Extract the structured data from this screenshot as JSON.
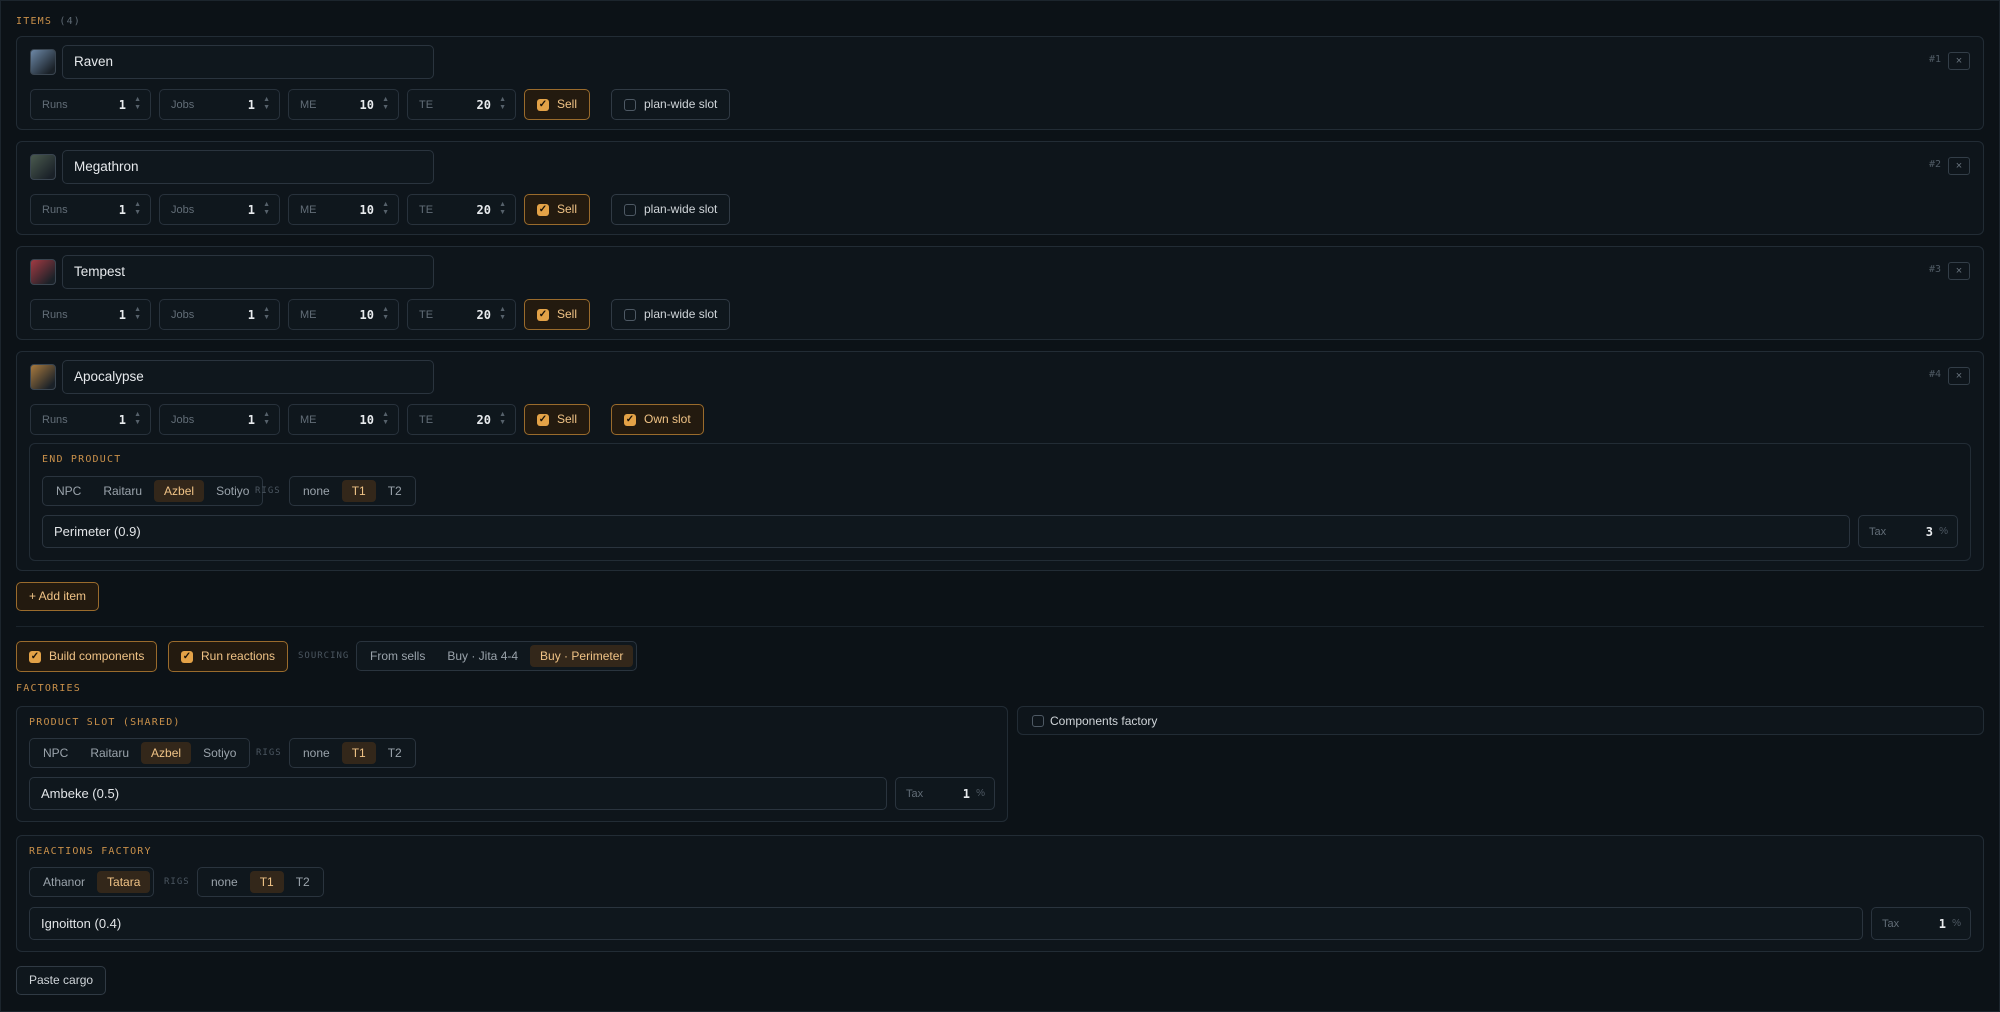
{
  "items_header": {
    "label": "ITEMS",
    "count": "(4)"
  },
  "field_labels": {
    "runs": "Runs",
    "jobs": "Jobs",
    "me": "ME",
    "te": "TE",
    "sell": "Sell",
    "plan_wide": "plan-wide slot",
    "own_slot": "Own slot",
    "tax": "Tax",
    "percent": "%",
    "remove": "×"
  },
  "items": [
    {
      "name": "Raven",
      "index": "#1",
      "runs": "1",
      "jobs": "1",
      "me": "10",
      "te": "20",
      "thumb_color": "#6d88a6"
    },
    {
      "name": "Megathron",
      "index": "#2",
      "runs": "1",
      "jobs": "1",
      "me": "10",
      "te": "20",
      "thumb_color": "#4a5a4e"
    },
    {
      "name": "Tempest",
      "index": "#3",
      "runs": "1",
      "jobs": "1",
      "me": "10",
      "te": "20",
      "thumb_color": "#a23a42"
    },
    {
      "name": "Apocalypse",
      "index": "#4",
      "runs": "1",
      "jobs": "1",
      "me": "10",
      "te": "20",
      "thumb_color": "#a87a3e"
    }
  ],
  "end_product": {
    "label": "END PRODUCT",
    "structures": [
      "NPC",
      "Raitaru",
      "Azbel",
      "Sotiyo"
    ],
    "selected_structure": "Azbel",
    "rigs_label": "RIGS",
    "rigs": [
      "none",
      "T1",
      "T2"
    ],
    "selected_rig": "T1",
    "system": "Perimeter (0.9)",
    "tax": "3"
  },
  "add_item": "+ Add item",
  "options": {
    "build_components": "Build components",
    "run_reactions": "Run reactions",
    "sourcing_label": "SOURCING",
    "sourcing": [
      "From sells",
      "Buy · Jita 4-4",
      "Buy · Perimeter"
    ],
    "selected_sourcing": "Buy · Perimeter"
  },
  "factories_label": "FACTORIES",
  "product_slot": {
    "label": "PRODUCT SLOT (SHARED)",
    "structures": [
      "NPC",
      "Raitaru",
      "Azbel",
      "Sotiyo"
    ],
    "selected_structure": "Azbel",
    "rigs_label": "RIGS",
    "rigs": [
      "none",
      "T1",
      "T2"
    ],
    "selected_rig": "T1",
    "system": "Ambeke (0.5)",
    "tax": "1"
  },
  "components_factory": "Components factory",
  "reactions_factory": {
    "label": "REACTIONS FACTORY",
    "structures": [
      "Athanor",
      "Tatara"
    ],
    "selected_structure": "Tatara",
    "rigs_label": "RIGS",
    "rigs": [
      "none",
      "T1",
      "T2"
    ],
    "selected_rig": "T1",
    "system": "Ignoitton (0.4)",
    "tax": "1"
  },
  "paste_cargo": "Paste cargo",
  "colors": {
    "accent": "#e3a247",
    "background": "#0c1217",
    "panel": "#0e151b"
  }
}
